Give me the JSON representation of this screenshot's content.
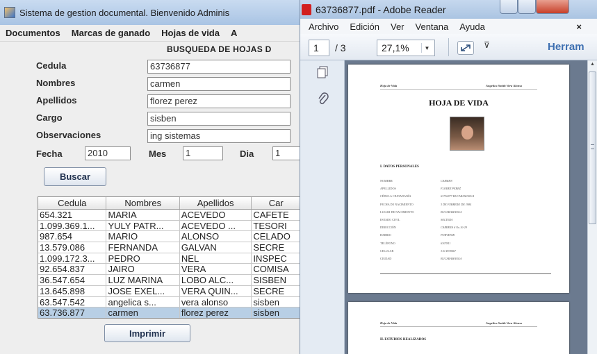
{
  "java_window": {
    "title": "Sistema de gestion documental. Bienvenido Adminis",
    "menu": [
      "Documentos",
      "Marcas de ganado",
      "Hojas de vida"
    ],
    "menu_cut": "A",
    "heading": "BUSQUEDA DE HOJAS D",
    "fields": {
      "cedula": {
        "label": "Cedula",
        "value": "63736877"
      },
      "nombres": {
        "label": "Nombres",
        "value": "carmen"
      },
      "apellidos": {
        "label": "Apellidos",
        "value": "florez perez"
      },
      "cargo": {
        "label": "Cargo",
        "value": "sisben"
      },
      "observaciones": {
        "label": "Observaciones",
        "value": "ing sistemas"
      }
    },
    "fecha": {
      "label": "Fecha",
      "value": "2010"
    },
    "mes": {
      "label": "Mes",
      "value": "1"
    },
    "dia": {
      "label": "Dia",
      "value": "1"
    },
    "buscar_label": "Buscar",
    "imprimir_label": "Imprimir",
    "table": {
      "headers": [
        "Cedula",
        "Nombres",
        "Apellidos",
        "Car"
      ],
      "rows": [
        [
          "654.321",
          "MARIA",
          "ACEVEDO",
          "CAFETE"
        ],
        [
          "1.099.369.1...",
          "YULY PATR...",
          "ACEVEDO ...",
          "TESORI"
        ],
        [
          "987.654",
          "MARIO",
          "ALONSO",
          "CELADO"
        ],
        [
          "13.579.086",
          "FERNANDA",
          "GALVAN",
          "SECRE"
        ],
        [
          "1.099.172.3...",
          "PEDRO",
          "NEL",
          "INSPEC"
        ],
        [
          "92.654.837",
          "JAIRO",
          "VERA",
          "COMISA"
        ],
        [
          "36.547.654",
          "LUZ MARINA",
          "LOBO ALC...",
          "SISBEN"
        ],
        [
          "13.645.898",
          "JOSE EXEL...",
          "VERA QUIN...",
          "SECRE"
        ],
        [
          "63.547.542",
          "angelica s...",
          "vera alonso",
          "sisben"
        ],
        [
          "63.736.877",
          "carmen",
          "florez perez",
          "sisben"
        ]
      ],
      "selected_row": 9
    }
  },
  "reader_window": {
    "title": "63736877.pdf - Adobe Reader",
    "menu": [
      "Archivo",
      "Edición",
      "Ver",
      "Ventana",
      "Ayuda"
    ],
    "close_glyph": "×",
    "page_current": "1",
    "page_total": "/ 3",
    "zoom": "27,1%",
    "tools_label": "Herram",
    "page1": {
      "header_left": "Hoja de Vida",
      "header_right": "Angelica Smith Vera Alonso",
      "title": "HOJA DE VIDA",
      "section1": "I.    DATOS PERSONALES",
      "rows": [
        [
          "NOMBRE",
          "CARMEN"
        ],
        [
          "APELLIDOS",
          "FLOREZ PEREZ"
        ],
        [
          "CÉDULA CIUDADANÍA",
          "63736877 BUCARAMANGA"
        ],
        [
          "FECHA DE NACIMIENTO",
          "3 DE FEBRERO DE 1984"
        ],
        [
          "LUGAR DE NACIMIENTO",
          "BUCARAMANGA"
        ],
        [
          "ESTADO CIVIL",
          "SOLTERA"
        ],
        [
          "DIRECCIÓN",
          "CARRERA 6 No.10-29"
        ],
        [
          "BARRIO",
          "PORVENIR"
        ],
        [
          "TELÉFONO",
          "6307811"
        ],
        [
          "CELULAR",
          "310 4938467"
        ],
        [
          "CIUDAD",
          "BUCARAMANGA"
        ]
      ]
    },
    "page2": {
      "header_left": "Hoja de Vida",
      "header_right": "Angelica Smith Vera Alonso",
      "section2": "II.    ESTUDIOS REALIZADOS"
    }
  }
}
